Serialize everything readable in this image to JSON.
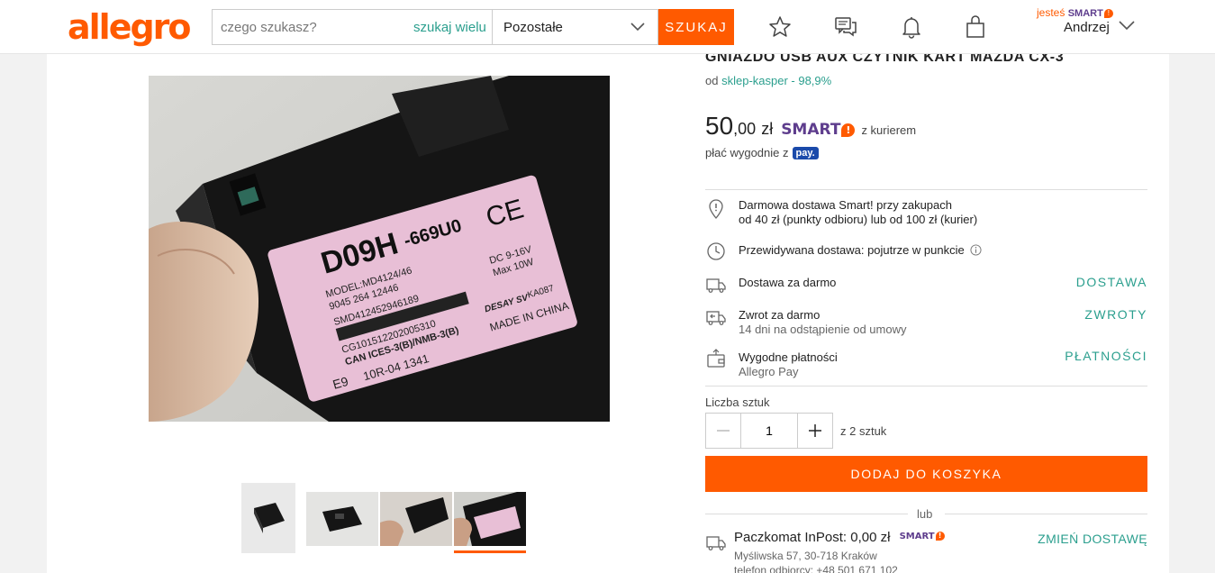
{
  "header": {
    "logo": "allegro",
    "search": {
      "placeholder": "czego szukasz?",
      "many_label": "szukaj wielu",
      "category": "Pozostałe",
      "button": "SZUKAJ"
    },
    "smart_prefix": "jesteś",
    "smart_word": "SMART",
    "user_name": "Andrzej"
  },
  "product": {
    "title": "GNIAZDO USB AUX CZYTNIK KART MAZDA CX-3",
    "seller_prefix": "od",
    "seller": "sklep-kasper - 98,9%",
    "price_main": "50",
    "price_frac": ",00",
    "price_currency": "zł",
    "smart_word": "SMART",
    "courier": "z kurierem",
    "pay_text": "płać wygodnie z",
    "pay_badge": "pay."
  },
  "delivery_info": [
    {
      "line1": "Darmowa dostawa Smart! przy zakupach",
      "line2": "od 40 zł (punkty odbioru) lub od 100 zł (kurier)",
      "link": ""
    },
    {
      "line1": "Przewidywana dostawa: pojutrze w punkcie",
      "line2": "",
      "link": ""
    },
    {
      "line1": "Dostawa za darmo",
      "line2": "",
      "link": "DOSTAWA"
    },
    {
      "line1": "Zwrot za darmo",
      "line2": "14 dni na odstąpienie od umowy",
      "link": "ZWROTY"
    },
    {
      "line1": "Wygodne płatności",
      "line2": "Allegro Pay",
      "link": "PŁATNOŚCI"
    }
  ],
  "purchase": {
    "qty_label": "Liczba sztuk",
    "qty_value": "1",
    "qty_of": "z 2 sztuk",
    "add_button": "DODAJ DO KOSZYKA",
    "or_text": "lub"
  },
  "parcel": {
    "title": "Paczkomat InPost: 0,00 zł",
    "smart_word": "SMART",
    "address": "Myśliwska 57, 30-718 Kraków",
    "phone": "telefon odbiorcy: +48 501 671 102",
    "change_link": "ZMIEŃ DOSTAWĘ"
  },
  "label_text": {
    "model_code": "D09H",
    "model_suffix": "-669U0",
    "model": "MODEL:MD4124/46",
    "line1": "9045 264 12446",
    "line2": "SMD412452946189",
    "line3": "CG101512202005310",
    "line4": "CAN ICES-3(B)/NMB-3(B)",
    "line5": "10R-04 1341",
    "dc": "DC 9-16V",
    "max": "Max 10W",
    "brand": "DESAY SV",
    "ka": "KA087",
    "made": "MADE IN CHINA",
    "ce": "CE",
    "e9": "E9"
  },
  "colors": {
    "brand": "#ff5a00",
    "link": "#2b9f8e",
    "smart": "#5e3d8d"
  }
}
